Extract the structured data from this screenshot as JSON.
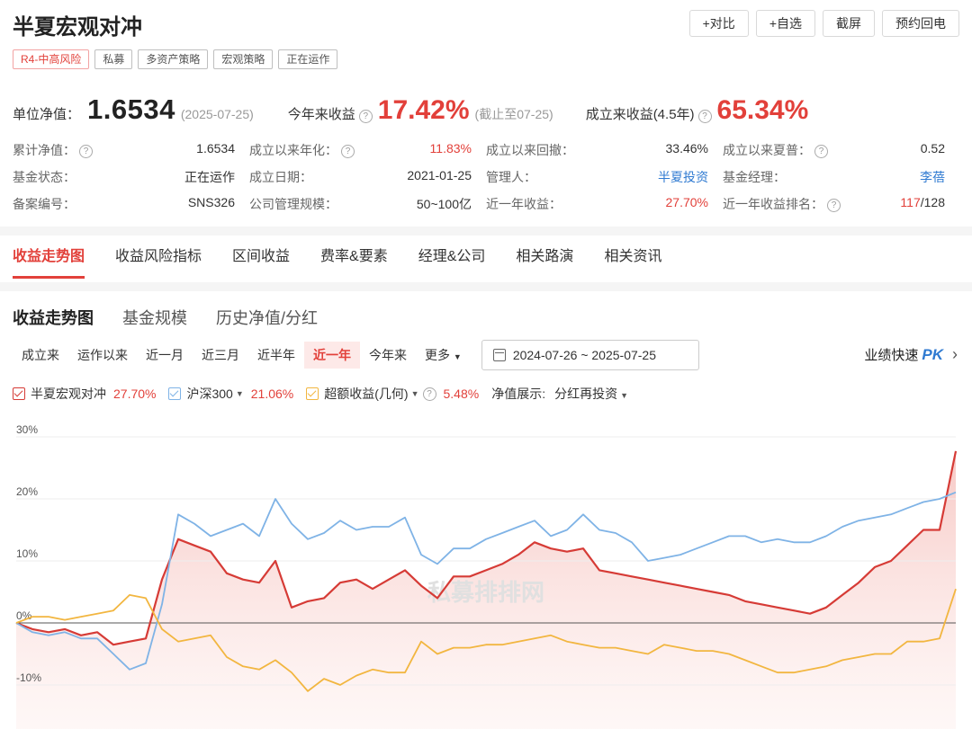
{
  "fund": {
    "title": "半夏宏观对冲",
    "tags": [
      "R4-中高风险",
      "私募",
      "多资产策略",
      "宏观策略",
      "正在运作"
    ]
  },
  "actions": [
    "+对比",
    "+自选",
    "截屏",
    "预约回电"
  ],
  "nav": {
    "unit_label": "单位净值：",
    "unit_value": "1.6534",
    "unit_date": "(2025-07-25)",
    "ytd_label": "今年来收益",
    "ytd_value": "17.42%",
    "ytd_note": "(截止至07-25)",
    "since_label": "成立来收益(4.5年)",
    "since_value": "65.34%"
  },
  "stats": [
    [
      {
        "k": "累计净值：",
        "q": true,
        "v": "1.6534",
        "style": ""
      },
      {
        "k": "成立以来年化：",
        "q": true,
        "v": "11.83%",
        "style": "red"
      },
      {
        "k": "成立以来回撤：",
        "q": false,
        "v": "33.46%",
        "style": ""
      },
      {
        "k": "成立以来夏普：",
        "q": true,
        "v": "0.52",
        "style": ""
      }
    ],
    [
      {
        "k": "基金状态：",
        "q": false,
        "v": "正在运作",
        "style": ""
      },
      {
        "k": "成立日期：",
        "q": false,
        "v": "2021-01-25",
        "style": ""
      },
      {
        "k": "管理人：",
        "q": false,
        "v": "半夏投资",
        "style": "blue"
      },
      {
        "k": "基金经理：",
        "q": false,
        "v": "李蓓",
        "style": "blue"
      }
    ],
    [
      {
        "k": "备案编号：",
        "q": false,
        "v": "SNS326",
        "style": ""
      },
      {
        "k": "公司管理规模：",
        "q": false,
        "v": "50~100亿",
        "style": ""
      },
      {
        "k": "近一年收益：",
        "q": false,
        "v": "27.70%",
        "style": "red"
      },
      {
        "k": "近一年收益排名：",
        "q": true,
        "v_red": "117",
        "v": "/128",
        "style": ""
      }
    ]
  ],
  "tabs": [
    "收益走势图",
    "收益风险指标",
    "区间收益",
    "费率&要素",
    "经理&公司",
    "相关路演",
    "相关资讯"
  ],
  "subtabs": [
    "收益走势图",
    "基金规模",
    "历史净值/分红"
  ],
  "ranges": [
    "成立来",
    "运作以来",
    "近一月",
    "近三月",
    "近半年",
    "近一年",
    "今年来",
    "更多"
  ],
  "date_range": "2024-07-26 ~ 2025-07-25",
  "pk": {
    "label": "业绩快速",
    "pk": "PK"
  },
  "legend": {
    "fund_name": "半夏宏观对冲",
    "fund_pct": "27.70%",
    "index_name": "沪深300",
    "index_pct": "21.06%",
    "excess_name": "超额收益(几何)",
    "excess_pct": "5.48%",
    "display_label": "净值展示:",
    "display_value": "分红再投资"
  },
  "colors": {
    "fund": "#d63b36",
    "index": "#7fb3e6",
    "excess": "#f2b640",
    "red": "#e2403a"
  },
  "chart_data": {
    "type": "line",
    "y_ticks": [
      "30%",
      "20%",
      "10%",
      "0%",
      "-10%"
    ],
    "ylim": [
      -15,
      30
    ],
    "grid": true,
    "watermark": "私募排排网",
    "series": [
      {
        "name": "半夏宏观对冲",
        "color": "#d63b36",
        "area": true,
        "values": [
          0,
          -1,
          -1.5,
          -1,
          -2,
          -1.5,
          -3.5,
          -3,
          -2.5,
          7,
          13.5,
          12.5,
          11.5,
          8,
          7,
          6.5,
          10,
          2.5,
          3.5,
          4,
          6.5,
          7,
          5.5,
          7,
          8.5,
          6,
          4,
          7.5,
          7.5,
          8.5,
          9.5,
          11,
          13,
          12,
          11.5,
          12,
          8.5,
          8,
          7.5,
          7,
          6.5,
          6,
          5.5,
          5,
          4.5,
          3.5,
          3,
          2.5,
          2,
          1.5,
          2.5,
          4.5,
          6.5,
          9,
          10,
          12.5,
          15,
          15,
          27.7
        ]
      },
      {
        "name": "沪深300",
        "color": "#7fb3e6",
        "area": false,
        "values": [
          0,
          -1.5,
          -2,
          -1.5,
          -2.5,
          -2.5,
          -5,
          -7.5,
          -6.5,
          3,
          17.5,
          16,
          14,
          15,
          16,
          14,
          20,
          16,
          13.5,
          14.5,
          16.5,
          15,
          15.5,
          15.5,
          17,
          11,
          9.5,
          12,
          12,
          13.5,
          14.5,
          15.5,
          16.5,
          14,
          15,
          17.5,
          15,
          14.5,
          13,
          10,
          10.5,
          11,
          12,
          13,
          14,
          14,
          13,
          13.5,
          13,
          13,
          14,
          15.5,
          16.5,
          17,
          17.5,
          18.5,
          19.5,
          20,
          21.06
        ]
      },
      {
        "name": "超额收益(几何)",
        "color": "#f2b640",
        "area": false,
        "values": [
          0,
          1,
          1,
          0.5,
          1,
          1.5,
          2,
          4.5,
          4,
          -1,
          -3,
          -2.5,
          -2,
          -5.5,
          -7,
          -7.5,
          -6,
          -8,
          -11,
          -9,
          -10,
          -8.5,
          -7.5,
          -8,
          -8,
          -3,
          -5,
          -4,
          -4,
          -3.5,
          -3.5,
          -3,
          -2.5,
          -2,
          -3,
          -3.5,
          -4,
          -4,
          -4.5,
          -5,
          -3.5,
          -4,
          -4.5,
          -4.5,
          -5,
          -6,
          -7,
          -8,
          -8,
          -7.5,
          -7,
          -6,
          -5.5,
          -5,
          -5,
          -3,
          -3,
          -2.5,
          5.48
        ]
      }
    ]
  }
}
